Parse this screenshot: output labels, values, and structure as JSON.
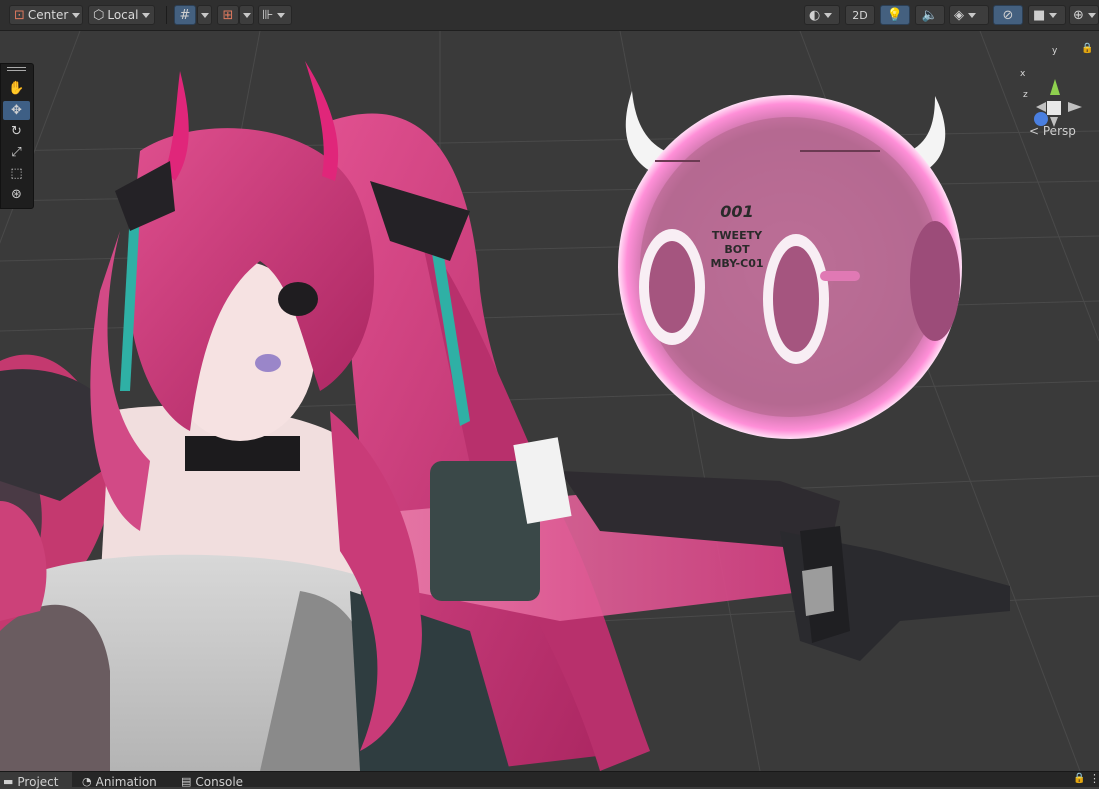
{
  "toolbar": {
    "pivot_label": "Center",
    "pivot_icon": "pivot-icon",
    "handle_label": "Local",
    "handle_icon": "local-cube-icon",
    "grid_icon": "grid-snap-icon",
    "increment_icon": "increment-snap-icon",
    "scene_view_2d": "2D",
    "lighting_icon": "lightbulb-icon",
    "audio_icon": "audio-icon",
    "effects_icon": "effects-layers-icon",
    "visibility_icon": "hidden-eye-icon",
    "camera_icon": "camera-icon",
    "gizmos_icon": "gizmos-globe-icon",
    "shading_icon": "shading-mode-icon",
    "accent_color": "#44607f"
  },
  "tools": [
    {
      "name": "view-tool-hand",
      "icon": "hand-icon"
    },
    {
      "name": "move-tool",
      "icon": "move-arrows-icon"
    },
    {
      "name": "rotate-tool",
      "icon": "rotate-icon"
    },
    {
      "name": "scale-tool",
      "icon": "scale-icon"
    },
    {
      "name": "rect-tool",
      "icon": "rect-icon"
    },
    {
      "name": "transform-tool",
      "icon": "transform-icon"
    }
  ],
  "gizmo": {
    "axis_y": "y",
    "axis_x": "x",
    "axis_z": "z",
    "projection_label": "Persp"
  },
  "bot": {
    "line1": "001",
    "line2": "TWEETY",
    "line3": "BOT",
    "line4": "MBY-C01"
  },
  "bottom_tabs": [
    {
      "label": "Project",
      "icon": "folder-icon"
    },
    {
      "label": "Animation",
      "icon": "animation-clock-icon"
    },
    {
      "label": "Console",
      "icon": "console-icon"
    }
  ]
}
